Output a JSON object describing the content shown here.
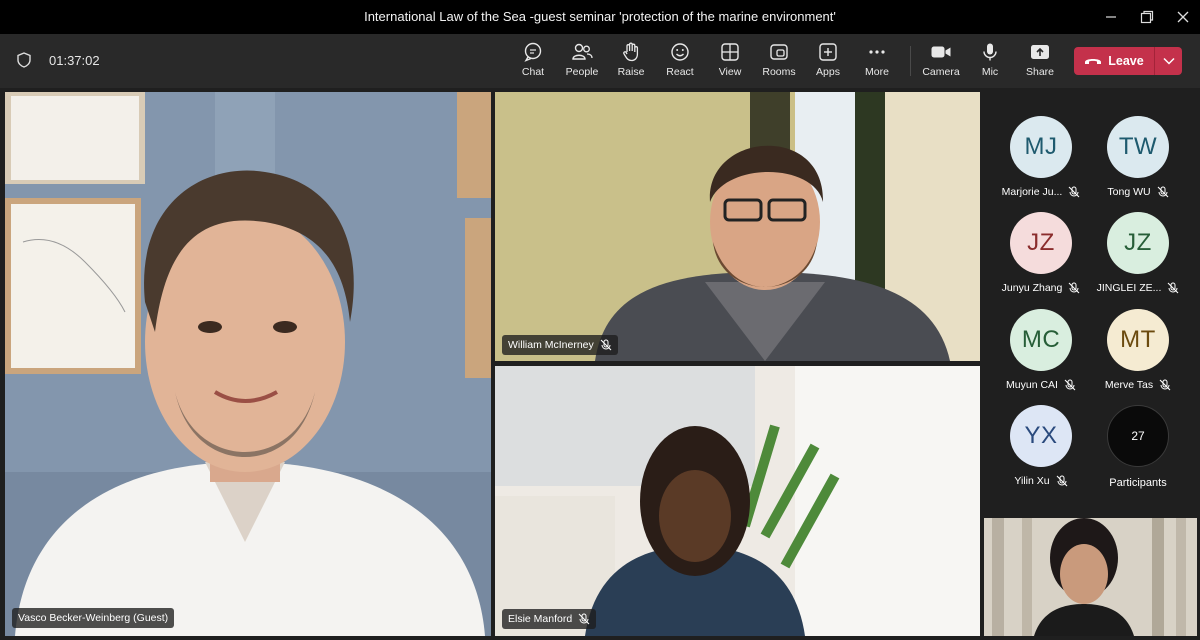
{
  "window": {
    "title": "International Law of the Sea -guest seminar 'protection of the marine environment'"
  },
  "toolbar": {
    "timer": "01:37:02",
    "chat": "Chat",
    "people": "People",
    "raise": "Raise",
    "react": "React",
    "view": "View",
    "rooms": "Rooms",
    "apps": "Apps",
    "more": "More",
    "camera": "Camera",
    "mic": "Mic",
    "share": "Share",
    "leave": "Leave"
  },
  "tiles": {
    "main": {
      "name": "Vasco Becker-Weinberg (Guest)"
    },
    "top_right": {
      "name": "William McInerney"
    },
    "bottom_right": {
      "name": "Elsie Manford"
    }
  },
  "gallery": {
    "people": [
      {
        "initials": "MJ",
        "name": "Marjorie Ju...",
        "bg": "#dbe9ef",
        "fg": "#1e5a6e"
      },
      {
        "initials": "TW",
        "name": "Tong WU",
        "bg": "#dbe9ef",
        "fg": "#1e5a6e"
      },
      {
        "initials": "JZ",
        "name": "Junyu Zhang",
        "bg": "#f5dcdc",
        "fg": "#8a2c2c"
      },
      {
        "initials": "JZ",
        "name": "JINGLEI ZE...",
        "bg": "#d9eedf",
        "fg": "#275e38"
      },
      {
        "initials": "MC",
        "name": "Muyun CAI",
        "bg": "#d9eedf",
        "fg": "#275e38"
      },
      {
        "initials": "MT",
        "name": "Merve Tas",
        "bg": "#f5ebd2",
        "fg": "#6b4a0e"
      },
      {
        "initials": "YX",
        "name": "Yilin Xu",
        "bg": "#dde6f5",
        "fg": "#2a4a7d"
      }
    ],
    "overflow_count": "27",
    "overflow_label": "Participants"
  },
  "colors": {
    "leave": "#c4314b",
    "toolbar": "#292929",
    "titlebar": "#000000"
  }
}
